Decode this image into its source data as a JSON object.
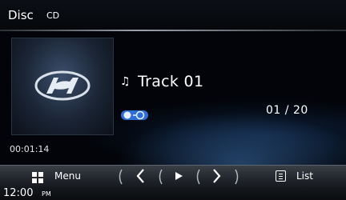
{
  "header": {
    "source": "Disc",
    "subtitle": "CD"
  },
  "now_playing": {
    "track_title": "Track 01",
    "elapsed": "00:01:14",
    "track_number": "01",
    "separator": "/",
    "track_total": "20"
  },
  "controls": {
    "menu_label": "Menu",
    "list_label": "List"
  },
  "status": {
    "time": "12:00",
    "ampm": "PM"
  },
  "icons": {
    "album": "hyundai-logo",
    "note": "music-note-icon",
    "mode": "shuffle-repeat-icon",
    "menu": "grid-menu-icon",
    "prev": "chevron-left-icon",
    "play": "play-icon",
    "next": "chevron-right-icon",
    "list": "list-icon"
  },
  "colors": {
    "accent_blue": "#2e6fd6",
    "background": "#020409",
    "bar": "#2a2f36"
  }
}
